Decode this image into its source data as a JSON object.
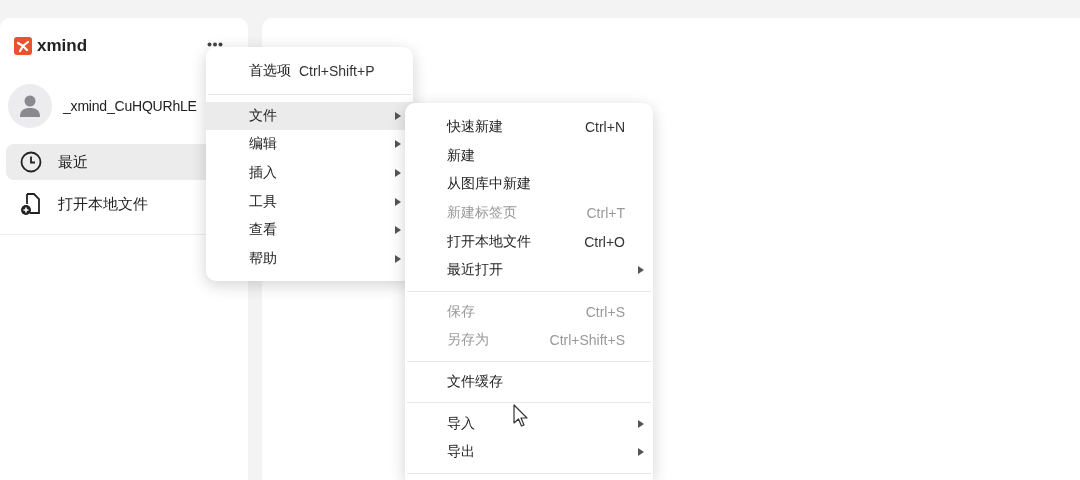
{
  "sidebar": {
    "logo": "xmind",
    "user": {
      "name": "_xmind_CuHQURhLE"
    },
    "items": [
      {
        "label": "最近",
        "selected": true
      },
      {
        "label": "打开本地文件",
        "selected": false
      }
    ]
  },
  "menu": {
    "items": [
      {
        "kind": "item",
        "label": "首选项",
        "shortcut": "Ctrl+Shift+P",
        "submenu": false,
        "selected": false
      },
      {
        "kind": "separator"
      },
      {
        "kind": "item",
        "label": "文件",
        "submenu": true,
        "selected": true
      },
      {
        "kind": "item",
        "label": "编辑",
        "submenu": true,
        "selected": false
      },
      {
        "kind": "item",
        "label": "插入",
        "submenu": true,
        "selected": false
      },
      {
        "kind": "item",
        "label": "工具",
        "submenu": true,
        "selected": false
      },
      {
        "kind": "item",
        "label": "查看",
        "submenu": true,
        "selected": false
      },
      {
        "kind": "item",
        "label": "帮助",
        "submenu": true,
        "selected": false
      }
    ]
  },
  "submenu": {
    "items": [
      {
        "kind": "item",
        "label": "快速新建",
        "shortcut": "Ctrl+N",
        "submenu": false,
        "disabled": false
      },
      {
        "kind": "item",
        "label": "新建",
        "submenu": false,
        "disabled": false
      },
      {
        "kind": "item",
        "label": "从图库中新建",
        "submenu": false,
        "disabled": false
      },
      {
        "kind": "item",
        "label": "新建标签页",
        "shortcut": "Ctrl+T",
        "submenu": false,
        "disabled": true
      },
      {
        "kind": "item",
        "label": "打开本地文件",
        "shortcut": "Ctrl+O",
        "submenu": false,
        "disabled": false
      },
      {
        "kind": "item",
        "label": "最近打开",
        "submenu": true,
        "disabled": false
      },
      {
        "kind": "separator"
      },
      {
        "kind": "item",
        "label": "保存",
        "shortcut": "Ctrl+S",
        "submenu": false,
        "disabled": true
      },
      {
        "kind": "item",
        "label": "另存为",
        "shortcut": "Ctrl+Shift+S",
        "submenu": false,
        "disabled": true
      },
      {
        "kind": "separator"
      },
      {
        "kind": "item",
        "label": "文件缓存",
        "submenu": false,
        "disabled": false
      },
      {
        "kind": "separator"
      },
      {
        "kind": "item",
        "label": "导入",
        "submenu": true,
        "disabled": false
      },
      {
        "kind": "item",
        "label": "导出",
        "submenu": true,
        "disabled": false
      },
      {
        "kind": "separator"
      }
    ]
  }
}
